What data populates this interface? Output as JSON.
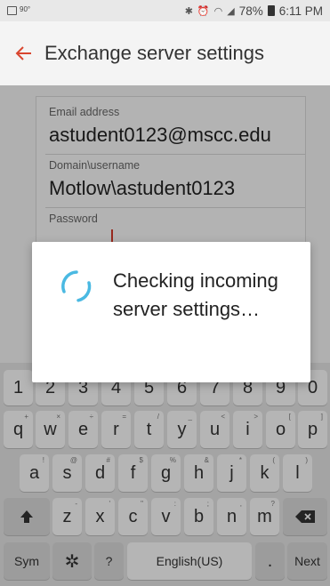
{
  "status_bar": {
    "temp": "90°",
    "battery": "78%",
    "time": "6:11 PM",
    "icons": [
      "bluetooth-icon",
      "alarm-icon",
      "wifi-icon",
      "signal-icon",
      "battery-charging-icon"
    ]
  },
  "app_bar": {
    "back_icon": "arrow-left-icon",
    "title": "Exchange server settings",
    "accent_color": "#d9462f"
  },
  "form": {
    "email_label": "Email address",
    "email_value": "astudent0123@mscc.edu",
    "domain_label": "Domain\\username",
    "domain_value": "Motlow\\astudent0123",
    "password_label": "Password"
  },
  "dialog": {
    "message": "Checking incoming server settings…",
    "spinner_color": "#4ab9e2"
  },
  "keyboard": {
    "number_row": [
      "1",
      "2",
      "3",
      "4",
      "5",
      "6",
      "7",
      "8",
      "9",
      "0"
    ],
    "row1": [
      "q",
      "w",
      "e",
      "r",
      "t",
      "y",
      "u",
      "i",
      "o",
      "p"
    ],
    "row1_sub": [
      "+",
      "×",
      "÷",
      "=",
      "/",
      "_",
      "<",
      ">",
      "[",
      "]"
    ],
    "row2": [
      "a",
      "s",
      "d",
      "f",
      "g",
      "h",
      "j",
      "k",
      "l"
    ],
    "row2_sub": [
      "!",
      "@",
      "#",
      "$",
      "%",
      "&",
      "*",
      "(",
      ")"
    ],
    "row3": [
      "z",
      "x",
      "c",
      "v",
      "b",
      "n",
      "m"
    ],
    "row3_sub": [
      "-",
      "'",
      "\"",
      ":",
      ";",
      ",",
      "?"
    ],
    "shift_icon": "shift-icon",
    "backspace_icon": "backspace-icon",
    "sym": "Sym",
    "settings_icon": "gear-icon",
    "question": "?",
    "space": "English(US)",
    "period": ".",
    "next": "Next"
  }
}
